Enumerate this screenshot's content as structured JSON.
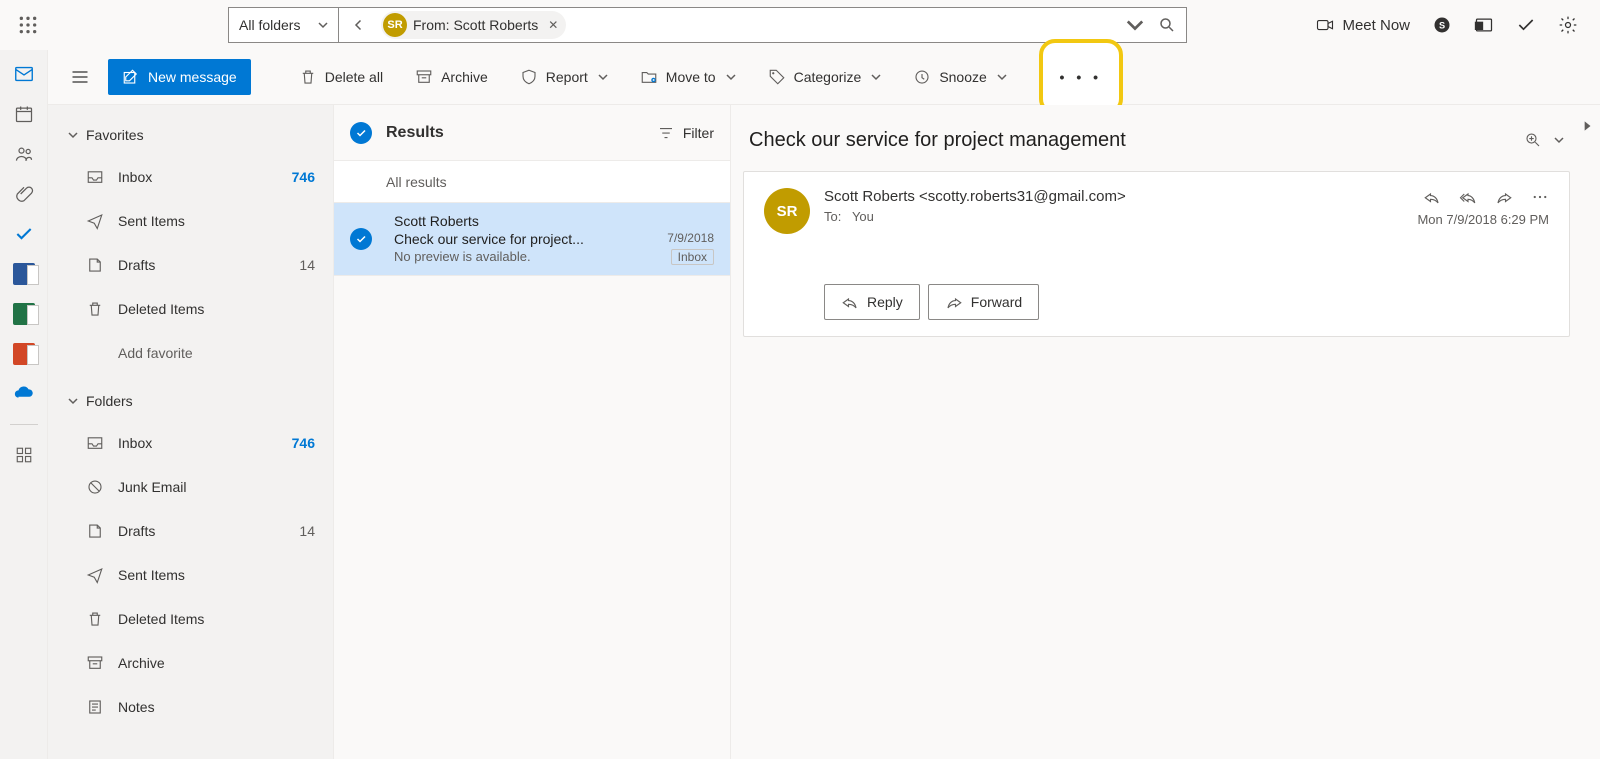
{
  "topbar": {
    "scope_label": "All folders",
    "chip_initials": "SR",
    "chip_text": "From: Scott Roberts",
    "meet_now": "Meet Now"
  },
  "cmd": {
    "new_message": "New message",
    "delete_all": "Delete all",
    "archive": "Archive",
    "report": "Report",
    "move_to": "Move to",
    "categorize": "Categorize",
    "snooze": "Snooze"
  },
  "nav": {
    "favorites": "Favorites",
    "folders": "Folders",
    "add_favorite": "Add favorite",
    "items": {
      "inbox": "Inbox",
      "sent": "Sent Items",
      "drafts": "Drafts",
      "deleted": "Deleted Items",
      "junk": "Junk Email",
      "archive": "Archive",
      "notes": "Notes"
    },
    "counts": {
      "inbox": "746",
      "drafts": "14"
    }
  },
  "list": {
    "results": "Results",
    "filter": "Filter",
    "all_results": "All results",
    "msg": {
      "from": "Scott Roberts",
      "subject": "Check our service for project...",
      "date": "7/9/2018",
      "preview": "No preview is available.",
      "badge": "Inbox"
    }
  },
  "reader": {
    "subject": "Check our service for project management",
    "avatar_initials": "SR",
    "sender": "Scott Roberts <scotty.roberts31@gmail.com>",
    "to_label": "To:",
    "to_value": "You",
    "datetime": "Mon 7/9/2018 6:29 PM",
    "reply": "Reply",
    "forward": "Forward"
  }
}
